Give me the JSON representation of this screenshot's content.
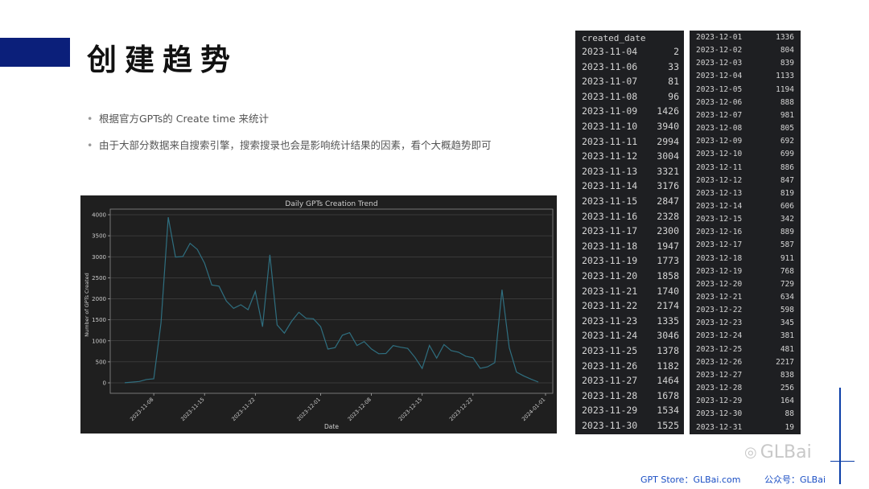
{
  "header": {
    "title": "创建趋势"
  },
  "bullets": [
    "根据官方GPTs的 Create time 来统计",
    "由于大部分数据来自搜索引擎，搜索搜录也会是影响统计结果的因素，看个大概趋势即可"
  ],
  "chart_data": {
    "type": "line",
    "title": "Daily GPTs Creation Trend",
    "xlabel": "Date",
    "ylabel": "Number of GPTs Created",
    "ylim": [
      0,
      4000
    ],
    "yticks": [
      0,
      500,
      1000,
      1500,
      2000,
      2500,
      3000,
      3500,
      4000
    ],
    "xticks": [
      "2023-11-08",
      "2023-11-15",
      "2023-11-22",
      "2023-12-01",
      "2023-12-08",
      "2023-12-15",
      "2023-12-22",
      "2024-01-01"
    ],
    "grid": true,
    "series": [
      {
        "x": [
          "2023-11-04",
          "2023-11-06",
          "2023-11-07",
          "2023-11-08",
          "2023-11-09",
          "2023-11-10",
          "2023-11-11",
          "2023-11-12",
          "2023-11-13",
          "2023-11-14",
          "2023-11-15",
          "2023-11-16",
          "2023-11-17",
          "2023-11-18",
          "2023-11-19",
          "2023-11-20",
          "2023-11-21",
          "2023-11-22",
          "2023-11-23",
          "2023-11-24",
          "2023-11-25",
          "2023-11-26",
          "2023-11-27",
          "2023-11-28",
          "2023-11-29",
          "2023-11-30",
          "2023-12-01",
          "2023-12-02",
          "2023-12-03",
          "2023-12-04",
          "2023-12-05",
          "2023-12-06",
          "2023-12-07",
          "2023-12-08",
          "2023-12-09",
          "2023-12-10",
          "2023-12-11",
          "2023-12-12",
          "2023-12-13",
          "2023-12-14",
          "2023-12-15",
          "2023-12-16",
          "2023-12-17",
          "2023-12-18",
          "2023-12-19",
          "2023-12-20",
          "2023-12-21",
          "2023-12-22",
          "2023-12-23",
          "2023-12-24",
          "2023-12-25",
          "2023-12-26",
          "2023-12-27",
          "2023-12-28",
          "2023-12-29",
          "2023-12-30",
          "2023-12-31"
        ],
        "values": [
          2,
          33,
          81,
          96,
          1426,
          3940,
          2994,
          3004,
          3321,
          3176,
          2847,
          2328,
          2300,
          1947,
          1773,
          1858,
          1740,
          2174,
          1335,
          3046,
          1378,
          1182,
          1464,
          1678,
          1534,
          1525,
          1336,
          804,
          839,
          1133,
          1194,
          888,
          981,
          805,
          692,
          699,
          886,
          847,
          819,
          606,
          342,
          889,
          587,
          911,
          768,
          729,
          634,
          598,
          345,
          381,
          481,
          2217,
          838,
          256,
          164,
          88,
          19
        ]
      }
    ]
  },
  "table_left": {
    "header": "created_date",
    "rows": [
      [
        "2023-11-04",
        "2"
      ],
      [
        "2023-11-06",
        "33"
      ],
      [
        "2023-11-07",
        "81"
      ],
      [
        "2023-11-08",
        "96"
      ],
      [
        "2023-11-09",
        "1426"
      ],
      [
        "2023-11-10",
        "3940"
      ],
      [
        "2023-11-11",
        "2994"
      ],
      [
        "2023-11-12",
        "3004"
      ],
      [
        "2023-11-13",
        "3321"
      ],
      [
        "2023-11-14",
        "3176"
      ],
      [
        "2023-11-15",
        "2847"
      ],
      [
        "2023-11-16",
        "2328"
      ],
      [
        "2023-11-17",
        "2300"
      ],
      [
        "2023-11-18",
        "1947"
      ],
      [
        "2023-11-19",
        "1773"
      ],
      [
        "2023-11-20",
        "1858"
      ],
      [
        "2023-11-21",
        "1740"
      ],
      [
        "2023-11-22",
        "2174"
      ],
      [
        "2023-11-23",
        "1335"
      ],
      [
        "2023-11-24",
        "3046"
      ],
      [
        "2023-11-25",
        "1378"
      ],
      [
        "2023-11-26",
        "1182"
      ],
      [
        "2023-11-27",
        "1464"
      ],
      [
        "2023-11-28",
        "1678"
      ],
      [
        "2023-11-29",
        "1534"
      ],
      [
        "2023-11-30",
        "1525"
      ]
    ]
  },
  "table_right": {
    "rows": [
      [
        "2023-12-01",
        "1336"
      ],
      [
        "2023-12-02",
        "804"
      ],
      [
        "2023-12-03",
        "839"
      ],
      [
        "2023-12-04",
        "1133"
      ],
      [
        "2023-12-05",
        "1194"
      ],
      [
        "2023-12-06",
        "888"
      ],
      [
        "2023-12-07",
        "981"
      ],
      [
        "2023-12-08",
        "805"
      ],
      [
        "2023-12-09",
        "692"
      ],
      [
        "2023-12-10",
        "699"
      ],
      [
        "2023-12-11",
        "886"
      ],
      [
        "2023-12-12",
        "847"
      ],
      [
        "2023-12-13",
        "819"
      ],
      [
        "2023-12-14",
        "606"
      ],
      [
        "2023-12-15",
        "342"
      ],
      [
        "2023-12-16",
        "889"
      ],
      [
        "2023-12-17",
        "587"
      ],
      [
        "2023-12-18",
        "911"
      ],
      [
        "2023-12-19",
        "768"
      ],
      [
        "2023-12-20",
        "729"
      ],
      [
        "2023-12-21",
        "634"
      ],
      [
        "2023-12-22",
        "598"
      ],
      [
        "2023-12-23",
        "345"
      ],
      [
        "2023-12-24",
        "381"
      ],
      [
        "2023-12-25",
        "481"
      ],
      [
        "2023-12-26",
        "2217"
      ],
      [
        "2023-12-27",
        "838"
      ],
      [
        "2023-12-28",
        "256"
      ],
      [
        "2023-12-29",
        "164"
      ],
      [
        "2023-12-30",
        "88"
      ],
      [
        "2023-12-31",
        "19"
      ]
    ]
  },
  "watermark": {
    "text": "GLBai"
  },
  "footer": {
    "left": "GPT Store：GLBai.com",
    "right": "公众号：GLBai"
  },
  "colors": {
    "accent": "#0b1f7a",
    "chart_bg": "#1f1f1f",
    "line": "#2f6f80",
    "footer": "#1a4ec4"
  }
}
